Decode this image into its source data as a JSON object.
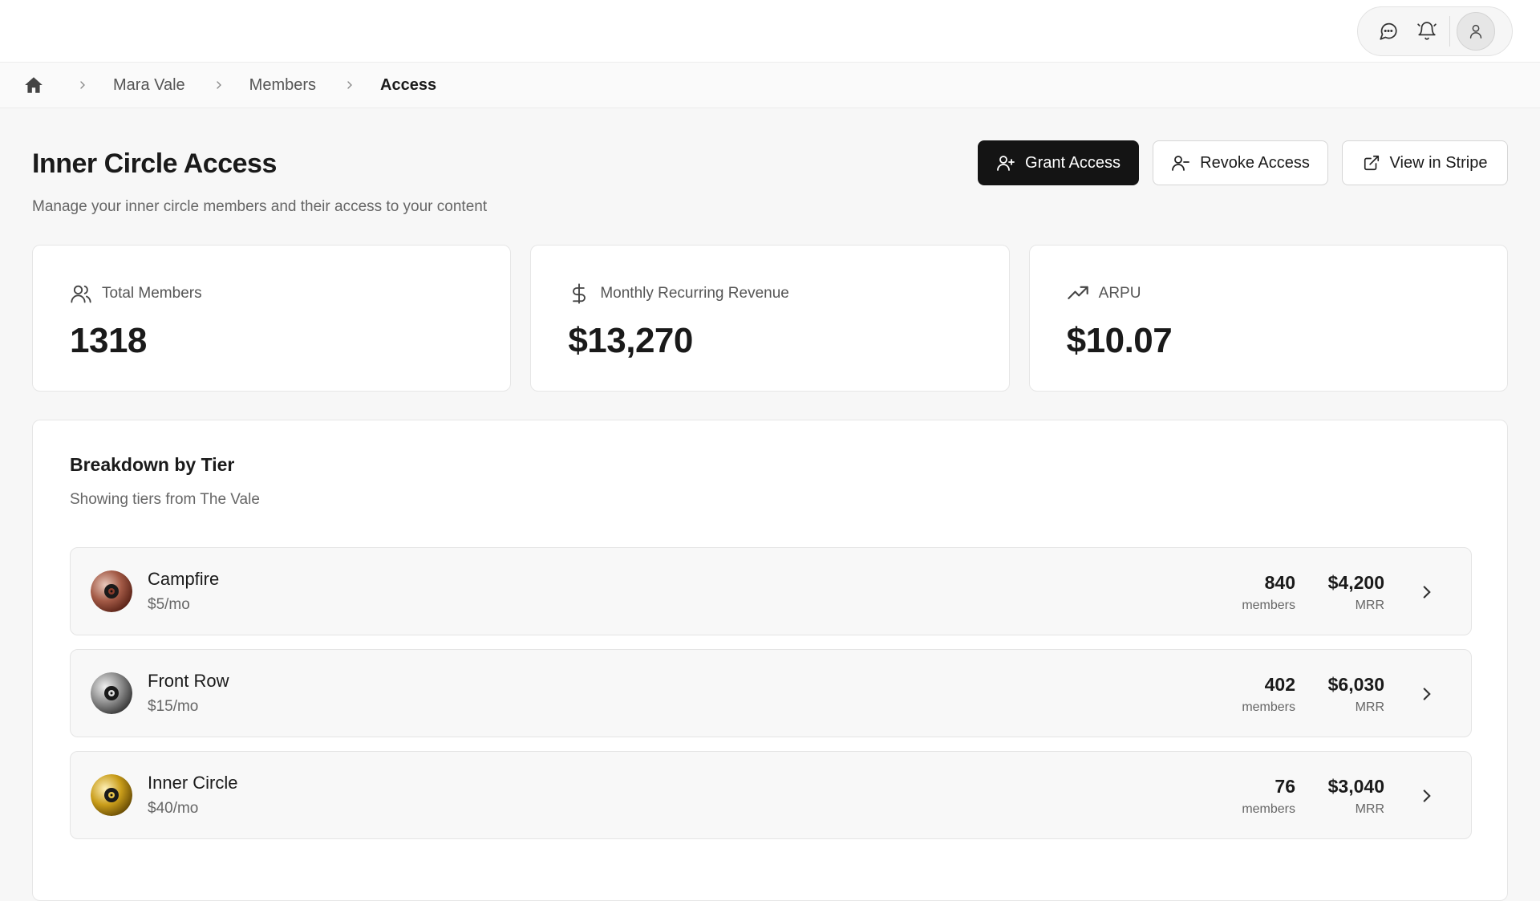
{
  "breadcrumb": {
    "items": [
      "Mara Vale",
      "Members"
    ],
    "current": "Access"
  },
  "page": {
    "title": "Inner Circle Access",
    "subtitle": "Manage your inner circle members and their access to your content"
  },
  "actions": {
    "grant": "Grant Access",
    "revoke": "Revoke Access",
    "stripe": "View in Stripe"
  },
  "stats": [
    {
      "label": "Total Members",
      "value": "1318",
      "icon": "users-icon"
    },
    {
      "label": "Monthly Recurring Revenue",
      "value": "$13,270",
      "icon": "dollar-icon"
    },
    {
      "label": "ARPU",
      "value": "$10.07",
      "icon": "trending-up-icon"
    }
  ],
  "breakdown": {
    "title": "Breakdown by Tier",
    "subtitle": "Showing tiers from The Vale",
    "tiers": [
      {
        "name": "Campfire",
        "price": "$5/mo",
        "members": "840",
        "members_label": "members",
        "mrr": "$4,200",
        "mrr_label": "MRR",
        "color": "#8a3a2a"
      },
      {
        "name": "Front Row",
        "price": "$15/mo",
        "members": "402",
        "members_label": "members",
        "mrr": "$6,030",
        "mrr_label": "MRR",
        "color": "#5a5a5a"
      },
      {
        "name": "Inner Circle",
        "price": "$40/mo",
        "members": "76",
        "members_label": "members",
        "mrr": "$3,040",
        "mrr_label": "MRR",
        "color": "#b8900a"
      }
    ]
  },
  "colors": {
    "primary": "#141414",
    "background": "#f7f7f7",
    "card": "#ffffff"
  }
}
